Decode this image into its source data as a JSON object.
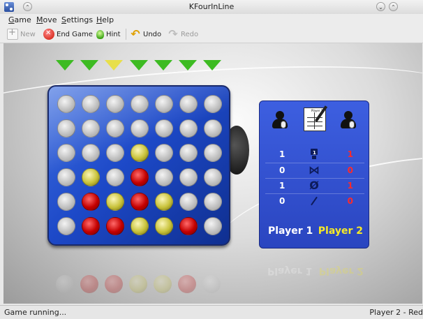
{
  "window": {
    "title": "KFourInLine"
  },
  "menu": [
    "Game",
    "Move",
    "Settings",
    "Help"
  ],
  "toolbar": {
    "new": "New",
    "end_game": "End Game",
    "hint": "Hint",
    "undo": "Undo",
    "redo": "Redo"
  },
  "board": {
    "columns": 7,
    "rows": 6,
    "column_arrows": [
      "green",
      "green",
      "yellow",
      "green",
      "green",
      "green",
      "green"
    ],
    "grid": [
      [
        "empty",
        "empty",
        "empty",
        "empty",
        "empty",
        "empty",
        "empty"
      ],
      [
        "empty",
        "empty",
        "empty",
        "empty",
        "empty",
        "empty",
        "empty"
      ],
      [
        "empty",
        "empty",
        "empty",
        "yellow",
        "empty",
        "empty",
        "empty"
      ],
      [
        "empty",
        "yellow",
        "empty",
        "red",
        "empty",
        "empty",
        "empty"
      ],
      [
        "empty",
        "red",
        "yellow",
        "red",
        "yellow",
        "empty",
        "empty"
      ],
      [
        "empty",
        "red",
        "red",
        "yellow",
        "yellow",
        "red",
        "empty"
      ]
    ]
  },
  "scores": {
    "note_label": "Player 1",
    "rows": [
      {
        "icon": "wins-icon",
        "p1": "1",
        "p2": "1",
        "badge": "1"
      },
      {
        "icon": "draws-icon",
        "p1": "0",
        "p2": "0"
      },
      {
        "icon": "losses-icon",
        "p1": "1",
        "p2": "1"
      },
      {
        "icon": "aborted-icon",
        "p1": "0",
        "p2": "0"
      }
    ],
    "player1": "Player 1",
    "player2": "Player 2",
    "player1_color": "#ffffff",
    "player2_color": "#f7ea26"
  },
  "status": {
    "left": "Game running...",
    "right": "Player 2 - Red"
  },
  "colors": {
    "board": "#1d49c8",
    "red_piece": "#c40000",
    "yellow_piece": "#c8c23a",
    "score_red": "#ff2a2a"
  }
}
